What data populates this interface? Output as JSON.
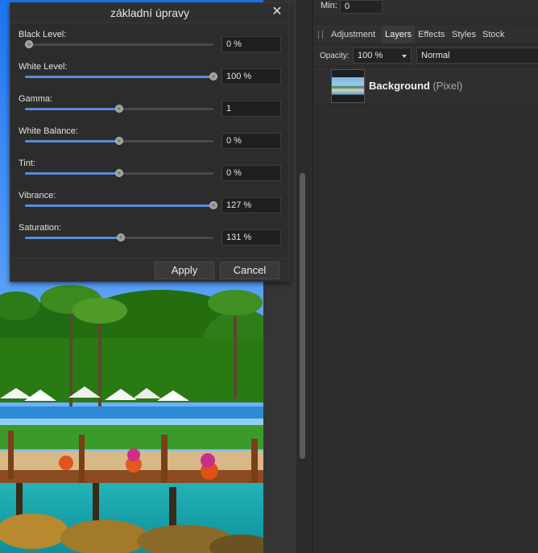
{
  "dialog": {
    "title": "základní úpravy",
    "close_glyph": "✕",
    "sliders": [
      {
        "label": "Black Level:",
        "value_text": "0 %",
        "fraction": 0.02
      },
      {
        "label": "White Level:",
        "value_text": "100 %",
        "fraction": 1.0
      },
      {
        "label": "Gamma:",
        "value_text": "1",
        "fraction": 0.5
      },
      {
        "label": "White Balance:",
        "value_text": "0 %",
        "fraction": 0.5
      },
      {
        "label": "Tint:",
        "value_text": "0 %",
        "fraction": 0.5
      },
      {
        "label": "Vibrance:",
        "value_text": "127 %",
        "fraction": 1.0
      },
      {
        "label": "Saturation:",
        "value_text": "131 %",
        "fraction": 0.51
      }
    ],
    "apply_label": "Apply",
    "cancel_label": "Cancel",
    "accent_color": "#5b8ad8"
  },
  "panel": {
    "min_label": "Min:",
    "min_value": "0",
    "tabs": [
      {
        "label": "Adjustment",
        "active": false
      },
      {
        "label": "Layers",
        "active": true
      },
      {
        "label": "Effects",
        "active": false
      },
      {
        "label": "Styles",
        "active": false
      },
      {
        "label": "Stock",
        "active": false
      }
    ],
    "opacity_label": "Opacity:",
    "opacity_value": "100 %",
    "blend_mode": "Normal",
    "layer": {
      "name": "Background",
      "type": "(Pixel)"
    }
  }
}
